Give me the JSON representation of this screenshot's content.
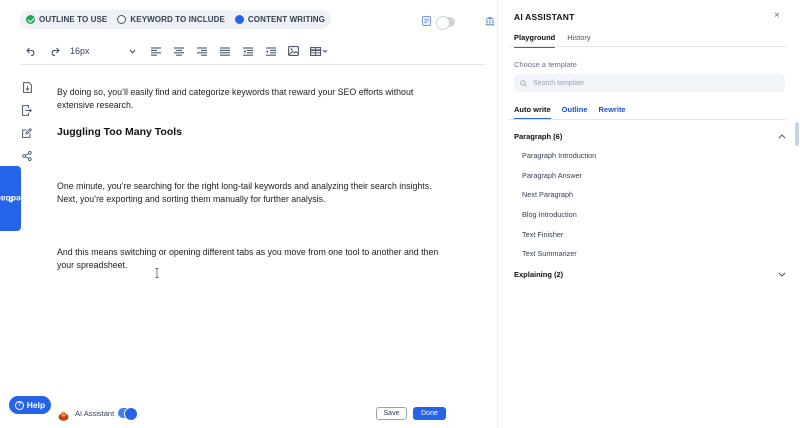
{
  "steps": [
    {
      "label": "OUTLINE TO USE",
      "state": "done"
    },
    {
      "label": "KEYWORD TO INCLUDE",
      "state": "empty"
    },
    {
      "label": "CONTENT WRITING",
      "state": "active"
    }
  ],
  "toolbar": {
    "font_size": "16px"
  },
  "feedback_label": "Feedback",
  "editor": {
    "para1": "By doing so, you’ll easily find and categorize keywords that reward your SEO efforts without extensive research.",
    "heading": "Juggling Too Many Tools",
    "para2": "One minute, you’re searching for the right long-tail keywords and analyzing their search insights. Next, you’re exporting and sorting them manually for further analysis.",
    "para3": "And this means switching or opening different tabs as you move from one tool to another and then your spreadsheet."
  },
  "bottom": {
    "help_label": "Help",
    "ai_label": "AI Assistant",
    "ai_enabled": true,
    "save_label": "Save",
    "done_label": "Done"
  },
  "panel": {
    "title": "AI ASSISTANT",
    "close_glyph": "×",
    "tabs": [
      "Playground",
      "History"
    ],
    "choose_label": "Choose a template",
    "search_placeholder": "Search template",
    "write_tabs": [
      "Auto write",
      "Outline",
      "Rewrite"
    ],
    "groups": [
      {
        "name": "Paragraph (6)",
        "expanded": true,
        "items": [
          "Paragraph Introduction",
          "Paragraph Answer",
          "Next Paragraph",
          "Blog Introduction",
          "Text Finisher",
          "Text Summarizer"
        ]
      },
      {
        "name": "Explaining (2)",
        "expanded": false,
        "items": []
      }
    ]
  },
  "colors": {
    "accent": "#2563eb",
    "done": "#22a55a"
  }
}
